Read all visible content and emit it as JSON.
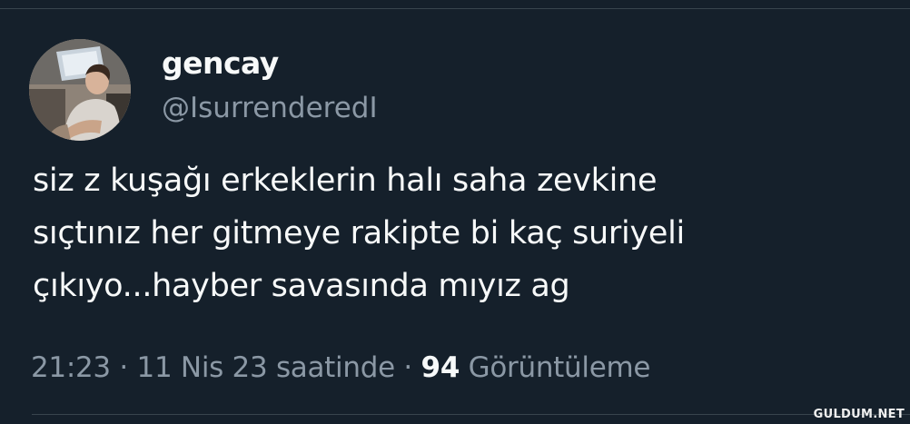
{
  "tweet": {
    "author": {
      "display_name": "gencay",
      "handle": "@IsurrenderedI"
    },
    "text_lines": [
      "siz z kuşağı erkeklerin halı saha zevkine",
      "sıçtınız her gitmeye rakipte bi kaç suriyeli",
      "çıkıyo...hayber savasında mıyız ag"
    ],
    "meta": {
      "time": "21:23",
      "separator": "·",
      "date": "11 Nis 23 saatinde",
      "view_count": "94",
      "view_label": "Görüntüleme"
    }
  },
  "watermark": "GULDUM.NET",
  "colors": {
    "background": "#15202b",
    "primary_text": "#f7f9f9",
    "secondary_text": "#8b98a5"
  }
}
